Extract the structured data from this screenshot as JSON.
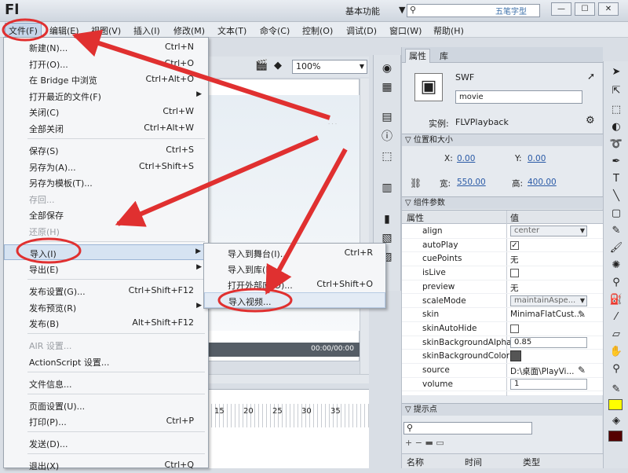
{
  "app": {
    "logo": "Fl",
    "workspace": "基本功能",
    "watermark": "五笔字型"
  },
  "menubar": [
    "文件(F)",
    "编辑(E)",
    "视图(V)",
    "插入(I)",
    "修改(M)",
    "文本(T)",
    "命令(C)",
    "控制(O)",
    "调试(D)",
    "窗口(W)",
    "帮助(H)"
  ],
  "file_menu": [
    {
      "label": "新建(N)...",
      "shortcut": "Ctrl+N"
    },
    {
      "label": "打开(O)...",
      "shortcut": "Ctrl+O"
    },
    {
      "label": "在 Bridge 中浏览",
      "shortcut": "Ctrl+Alt+O"
    },
    {
      "label": "打开最近的文件(F)",
      "shortcut": ""
    },
    {
      "label": "关闭(C)",
      "shortcut": "Ctrl+W"
    },
    {
      "label": "全部关闭",
      "shortcut": "Ctrl+Alt+W"
    },
    {
      "label": "保存(S)",
      "shortcut": "Ctrl+S"
    },
    {
      "label": "另存为(A)...",
      "shortcut": "Ctrl+Shift+S"
    },
    {
      "label": "另存为模板(T)...",
      "shortcut": ""
    },
    {
      "label": "存回...",
      "shortcut": ""
    },
    {
      "label": "全部保存",
      "shortcut": ""
    },
    {
      "label": "还原(H)",
      "shortcut": ""
    },
    {
      "label": "导入(I)",
      "shortcut": ""
    },
    {
      "label": "导出(E)",
      "shortcut": ""
    },
    {
      "label": "发布设置(G)...",
      "shortcut": "Ctrl+Shift+F12"
    },
    {
      "label": "发布预览(R)",
      "shortcut": ""
    },
    {
      "label": "发布(B)",
      "shortcut": "Alt+Shift+F12"
    },
    {
      "label": "AIR 设置...",
      "shortcut": ""
    },
    {
      "label": "ActionScript 设置...",
      "shortcut": ""
    },
    {
      "label": "文件信息...",
      "shortcut": ""
    },
    {
      "label": "页面设置(U)...",
      "shortcut": ""
    },
    {
      "label": "打印(P)...",
      "shortcut": "Ctrl+P"
    },
    {
      "label": "发送(D)...",
      "shortcut": ""
    },
    {
      "label": "退出(X)",
      "shortcut": "Ctrl+Q"
    }
  ],
  "import_submenu": [
    {
      "label": "导入到舞台(I)...",
      "shortcut": "Ctrl+R"
    },
    {
      "label": "导入到库(L)...",
      "shortcut": ""
    },
    {
      "label": "打开外部库(O)...",
      "shortcut": "Ctrl+Shift+O"
    },
    {
      "label": "导入视频...",
      "shortcut": ""
    }
  ],
  "stage": {
    "zoom": "100%",
    "timecode": "00:00/00:00"
  },
  "timeline": {
    "frames": [
      "15",
      "20",
      "25",
      "30",
      "35"
    ]
  },
  "properties": {
    "tabs": [
      "属性",
      "库"
    ],
    "type": "SWF",
    "instance_name": "movie",
    "instance_label": "实例:",
    "component": "FLVPlayback",
    "pos_section": "位置和大小",
    "x_label": "X:",
    "x": "0.00",
    "y_label": "Y:",
    "y": "0.00",
    "w_label": "宽:",
    "w": "550.00",
    "h_label": "高:",
    "h": "400.00",
    "params_section": "组件参数",
    "col_prop": "属性",
    "col_val": "值",
    "params": [
      {
        "name": "align",
        "value": "center",
        "kind": "drop"
      },
      {
        "name": "autoPlay",
        "value": "✓",
        "kind": "check"
      },
      {
        "name": "cuePoints",
        "value": "无",
        "kind": "text"
      },
      {
        "name": "isLive",
        "value": "",
        "kind": "check"
      },
      {
        "name": "preview",
        "value": "无",
        "kind": "text"
      },
      {
        "name": "scaleMode",
        "value": "maintainAspe...",
        "kind": "drop"
      },
      {
        "name": "skin",
        "value": "MinimaFlatCust...",
        "kind": "text"
      },
      {
        "name": "skinAutoHide",
        "value": "",
        "kind": "check"
      },
      {
        "name": "skinBackgroundAlpha",
        "value": "0.85",
        "kind": "box"
      },
      {
        "name": "skinBackgroundColor",
        "value": "",
        "kind": "swatch"
      },
      {
        "name": "source",
        "value": "D:\\桌面\\PlayVi...",
        "kind": "text"
      },
      {
        "name": "volume",
        "value": "1",
        "kind": "box"
      }
    ],
    "cue_section": "提示点",
    "cue_cols": [
      "名称",
      "时间",
      "类型"
    ]
  },
  "colors": {
    "annotation": "#e03030",
    "stroke": "#000000",
    "fill": "#ffff00",
    "fill2": "#550000"
  }
}
